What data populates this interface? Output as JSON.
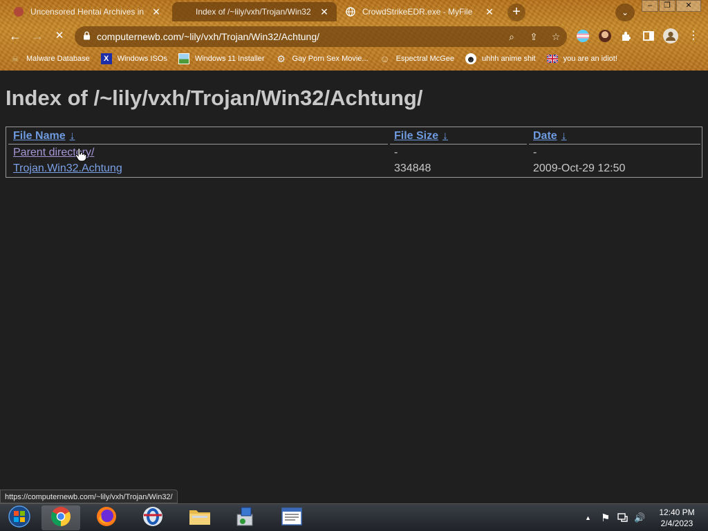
{
  "tabs": [
    {
      "title": "Uncensored Hentai Archives in - H",
      "close": "✕"
    },
    {
      "title": "Index of /~lily/vxh/Trojan/Win32",
      "close": "✕"
    },
    {
      "title": "CrowdStrikeEDR.exe - MyFile",
      "close": "✕"
    }
  ],
  "new_tab_label": "+",
  "tab_search_label": "⌄",
  "window_controls": {
    "minimize": "–",
    "maximize": "❐",
    "close": "✕"
  },
  "nav": {
    "back": "←",
    "forward": "→",
    "stop": "✕"
  },
  "address_bar": {
    "url": "computernewb.com/~lily/vxh/Trojan/Win32/Achtung/"
  },
  "omnibox_icons": {
    "search": "⌕",
    "share": "⇪",
    "star": "☆"
  },
  "bookmarks": [
    {
      "label": "Malware Database",
      "icon": "skull-icon",
      "glyph": "☠"
    },
    {
      "label": "Windows ISOs",
      "icon": "x-icon",
      "glyph": "X"
    },
    {
      "label": "Windows 11 Installer",
      "icon": "image-icon",
      "glyph": ""
    },
    {
      "label": "Gay Porn Sex Movie...",
      "icon": "gear-icon",
      "glyph": "⚙"
    },
    {
      "label": "Espectral McGee",
      "icon": "face-icon",
      "glyph": "☺"
    },
    {
      "label": "uhhh anime shit",
      "icon": "anime-face-icon",
      "glyph": "☻"
    },
    {
      "label": "you are an idiot!",
      "icon": "flag-uk-icon",
      "glyph": ""
    }
  ],
  "page": {
    "heading": "Index of /~lily/vxh/Trojan/Win32/Achtung/",
    "columns": [
      {
        "label": "File Name",
        "sort": "↓"
      },
      {
        "label": "File Size",
        "sort": "↓"
      },
      {
        "label": "Date",
        "sort": "↓"
      }
    ],
    "rows": [
      {
        "name": "Parent directory/",
        "size": "-",
        "date": "-"
      },
      {
        "name": "Trojan.Win32.Achtung",
        "size": "334848",
        "date": "2009-Oct-29 12:50"
      }
    ]
  },
  "status_bar": {
    "text": "https://computernewb.com/~lily/vxh/Trojan/Win32/"
  },
  "taskbar": {
    "clock_time": "12:40 PM",
    "clock_date": "2/4/2023",
    "tray_chevron": "▲",
    "tray_flag": "⚑",
    "tray_volume": "🔊"
  }
}
